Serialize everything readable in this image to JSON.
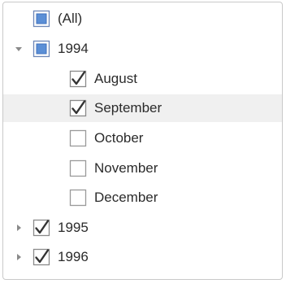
{
  "tree": {
    "items": [
      {
        "label": "(All)",
        "state": "indeterminate",
        "level": 0,
        "expander": "none"
      },
      {
        "label": "1994",
        "state": "indeterminate",
        "level": 0,
        "expander": "expanded"
      },
      {
        "label": "August",
        "state": "checked",
        "level": 1,
        "expander": "none"
      },
      {
        "label": "September",
        "state": "checked",
        "level": 1,
        "expander": "none",
        "selected": true
      },
      {
        "label": "October",
        "state": "unchecked",
        "level": 1,
        "expander": "none"
      },
      {
        "label": "November",
        "state": "unchecked",
        "level": 1,
        "expander": "none"
      },
      {
        "label": "December",
        "state": "unchecked",
        "level": 1,
        "expander": "none"
      },
      {
        "label": "1995",
        "state": "checked",
        "level": 0,
        "expander": "collapsed"
      },
      {
        "label": "1996",
        "state": "checked",
        "level": 0,
        "expander": "collapsed"
      }
    ]
  },
  "colors": {
    "indeterminate_fill": "#5b8fd6",
    "checkbox_border": "#8a8a8a",
    "check_mark": "#333333",
    "selected_row": "#f0f0f0",
    "expander": "#8a8a8a"
  }
}
